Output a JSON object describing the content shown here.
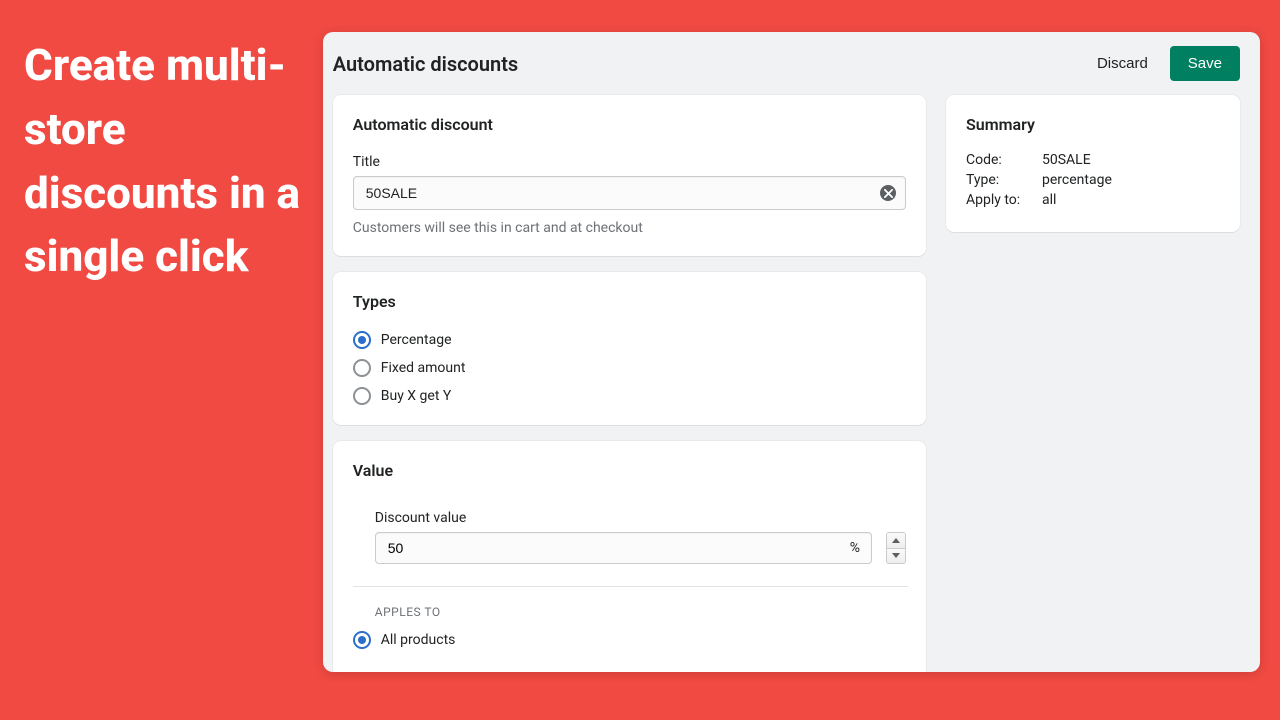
{
  "hero": "Create multi-store discounts in a single click",
  "page_title": "Automatic discounts",
  "actions": {
    "discard": "Discard",
    "save": "Save"
  },
  "discount": {
    "card_title": "Automatic discount",
    "title_label": "Title",
    "title_value": "50SALE",
    "title_help": "Customers will see this in cart and at checkout"
  },
  "types": {
    "card_title": "Types",
    "options": [
      "Percentage",
      "Fixed amount",
      "Buy X get Y"
    ],
    "selected_index": 0
  },
  "value": {
    "card_title": "Value",
    "discount_label": "Discount value",
    "discount_value": "50",
    "unit": "%",
    "applies_label": "APPLES TO",
    "applies_option": "All products"
  },
  "summary": {
    "title": "Summary",
    "rows": {
      "code": {
        "label": "Code:",
        "value": "50SALE"
      },
      "type": {
        "label": "Type:",
        "value": "percentage"
      },
      "apply": {
        "label": "Apply to:",
        "value": "all"
      }
    }
  }
}
